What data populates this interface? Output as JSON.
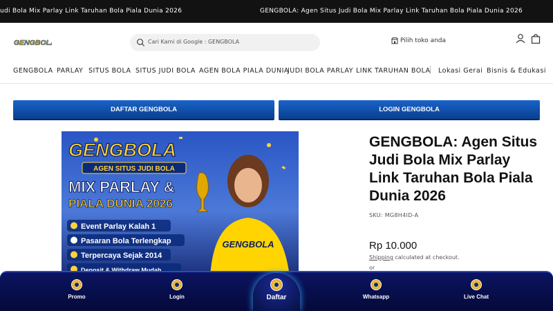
{
  "announcement": {
    "left_text": "udi Bola Mix Parlay Link Taruhan Bola Piala Dunia 2026",
    "right_text": "GENGBOLA: Agen Situs Judi Bola Mix Parlay Link Taruhan Bola Piala Dunia 2026"
  },
  "header": {
    "logo_text": "GENGBOLA",
    "search_placeholder": "Cari Kami di Google : GENGBOLA",
    "store_label": "Pilih toko anda"
  },
  "nav": {
    "items": [
      "GENGBOLA",
      "PARLAY",
      "SITUS BOLA",
      "SITUS JUDI BOLA",
      "AGEN BOLA PIALA DUNIA",
      "JUDI BOLA PARLAY",
      "LINK TARUHAN BOLA",
      "Lokasi Gerai",
      "Bisnis & Edukasi"
    ]
  },
  "cta": {
    "daftar": "DAFTAR GENGBOLA",
    "login": "LOGIN GENGBOLA"
  },
  "banner": {
    "brand": "GENGBOLA",
    "ribbon": "AGEN SITUS JUDI BOLA",
    "headline_1": "MIX PARLAY &",
    "headline_2": "PIALA DUNIA 2026",
    "features": [
      "Event Parlay Kalah 1",
      "Pasaran Bola Terlengkap",
      "Terpercaya Sejak 2014",
      "Deposit & Withdraw Mudah"
    ],
    "shirt_text": "GENGBOLA"
  },
  "product": {
    "title": "GENGBOLA: Agen Situs Judi Bola Mix Parlay Link Taruhan Bola Piala Dunia 2026",
    "sku": "SKU: MG8H4ID-A",
    "price": "Rp 10.000",
    "shipping_link": "Shipping",
    "shipping_rest": " calculated at checkout.",
    "or": "or"
  },
  "bottom_nav": {
    "promo": "Promo",
    "login": "Login",
    "daftar": "Daftar",
    "whatsapp": "Whatsapp",
    "livechat": "Live Chat"
  },
  "colors": {
    "accent_blue": "#0a3f8f",
    "bottom_bar": "#05093a",
    "gold": "#f2b500"
  }
}
